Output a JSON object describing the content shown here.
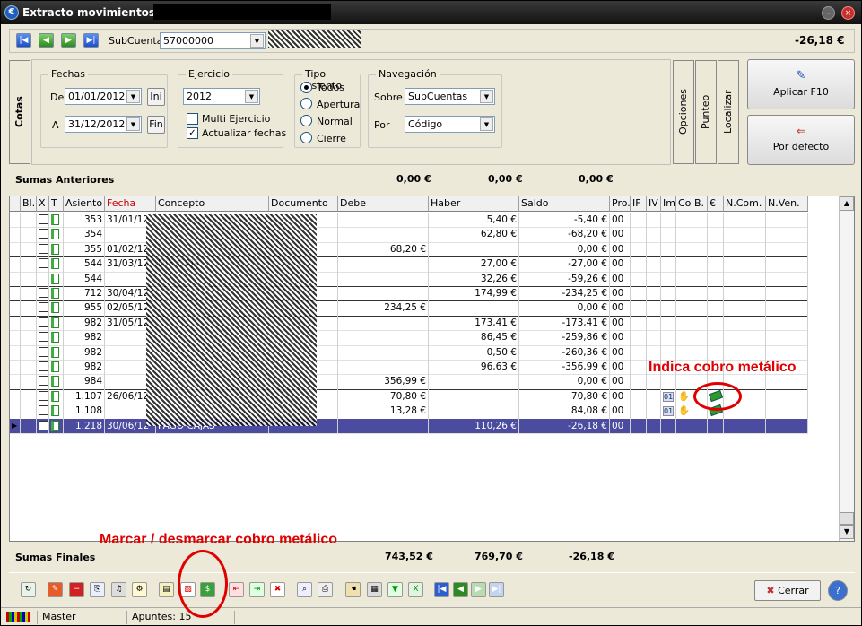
{
  "window": {
    "title": "Extracto movimientos - 5C"
  },
  "header": {
    "subcuenta_label": "SubCuenta",
    "subcuenta_value": "57000000",
    "balance": "-26,18 €"
  },
  "side_tab": "Cotas",
  "filters": {
    "fechas": {
      "title": "Fechas",
      "de_label": "De",
      "de_value": "01/01/2012",
      "ini_button": "Ini",
      "a_label": "A",
      "a_value": "31/12/2012",
      "fin_button": "Fin"
    },
    "ejercicio": {
      "title": "Ejercicio",
      "value": "2012",
      "multi_label": "Multi Ejercicio",
      "multi_checked": false,
      "actualizar_label": "Actualizar fechas",
      "actualizar_checked": true
    },
    "tipo_asiento": {
      "title": "Tipo Asiento",
      "options": [
        "Todos",
        "Apertura",
        "Normal",
        "Cierre"
      ],
      "selected": "Todos"
    },
    "navegacion": {
      "title": "Navegación",
      "sobre_label": "Sobre",
      "sobre_value": "SubCuentas",
      "por_label": "Por",
      "por_value": "Código"
    }
  },
  "vertical_tabs": [
    "Opciones",
    "Punteo",
    "Localizar"
  ],
  "actions": {
    "aplicar": "Aplicar F10",
    "defecto": "Por defecto"
  },
  "sumas_anteriores": {
    "label": "Sumas Anteriores",
    "debe": "0,00 €",
    "haber": "0,00 €",
    "saldo": "0,00 €"
  },
  "table": {
    "columns": [
      "Bl.",
      "X",
      "T",
      "Asiento",
      "Fecha",
      "Concepto",
      "Documento",
      "Debe",
      "Haber",
      "Saldo",
      "Pro.",
      "IF",
      "IV",
      "Im",
      "Co",
      "B.",
      "€",
      "N.Com.",
      "N.Ven."
    ],
    "rows": [
      {
        "asiento": "353",
        "fecha": "31/01/12",
        "concepto": "",
        "debe": "",
        "haber": "5,40 €",
        "saldo": "-5,40 €",
        "pro": "00",
        "cash": false
      },
      {
        "asiento": "354",
        "fecha": "",
        "concepto": "",
        "debe": "",
        "haber": "62,80 €",
        "saldo": "-68,20 €",
        "pro": "00",
        "cash": false
      },
      {
        "asiento": "355",
        "fecha": "01/02/12",
        "concepto": "",
        "debe": "68,20 €",
        "haber": "",
        "saldo": "0,00 €",
        "pro": "00",
        "cash": false
      },
      {
        "asiento": "544",
        "fecha": "31/03/12",
        "concepto": "DIF. CAJA",
        "debe": "",
        "haber": "27,00 €",
        "saldo": "-27,00 €",
        "pro": "00",
        "cash": false
      },
      {
        "asiento": "544",
        "fecha": "",
        "concepto": "",
        "debe": "",
        "haber": "32,26 €",
        "saldo": "-59,26 €",
        "pro": "00",
        "cash": false
      },
      {
        "asiento": "712",
        "fecha": "30/04/12",
        "concepto": "",
        "debe": "",
        "haber": "174,99 €",
        "saldo": "-234,25 €",
        "pro": "00",
        "cash": false
      },
      {
        "asiento": "955",
        "fecha": "02/05/12",
        "concepto": "",
        "debe": "234,25 €",
        "haber": "",
        "saldo": "0,00 €",
        "pro": "00",
        "cash": false
      },
      {
        "asiento": "982",
        "fecha": "31/05/12",
        "concepto": "",
        "debe": "",
        "haber": "173,41 €",
        "saldo": "-173,41 €",
        "pro": "00",
        "cash": false
      },
      {
        "asiento": "982",
        "fecha": "",
        "concepto": "",
        "debe": "",
        "haber": "86,45 €",
        "saldo": "-259,86 €",
        "pro": "00",
        "cash": false
      },
      {
        "asiento": "982",
        "fecha": "",
        "concepto": "",
        "debe": "",
        "haber": "0,50 €",
        "saldo": "-260,36 €",
        "pro": "00",
        "cash": false
      },
      {
        "asiento": "982",
        "fecha": "",
        "concepto": "",
        "debe": "",
        "haber": "96,63 €",
        "saldo": "-356,99 €",
        "pro": "00",
        "cash": false
      },
      {
        "asiento": "984",
        "fecha": "",
        "concepto": "",
        "debe": "356,99 €",
        "haber": "",
        "saldo": "0,00 €",
        "pro": "00",
        "cash": false
      },
      {
        "asiento": "1.107",
        "fecha": "26/06/12",
        "concepto": "",
        "debe": "70,80 €",
        "haber": "",
        "saldo": "70,80 €",
        "pro": "00",
        "cash": true
      },
      {
        "asiento": "1.108",
        "fecha": "",
        "concepto": "",
        "debe": "13,28 €",
        "haber": "",
        "saldo": "84,08 €",
        "pro": "00",
        "cash": true
      },
      {
        "asiento": "1.218",
        "fecha": "30/06/12",
        "concepto": "PAGO CAJAS",
        "debe": "",
        "haber": "110,26 €",
        "saldo": "-26,18 €",
        "pro": "00",
        "cash": false
      }
    ]
  },
  "sumas_finales": {
    "label": "Sumas Finales",
    "debe": "743,52 €",
    "haber": "769,70 €",
    "saldo": "-26,18 €"
  },
  "buttons": {
    "cerrar": "Cerrar"
  },
  "status": {
    "user": "Master",
    "apuntes": "Apuntes: 15"
  },
  "annotations": {
    "indica": "Indica cobro metálico",
    "marcar": "Marcar / desmarcar cobro metálico"
  },
  "colors": {
    "selected_row": "#4b4ba0",
    "annotation": "#e00000",
    "fecha_header": "#cc0000"
  }
}
